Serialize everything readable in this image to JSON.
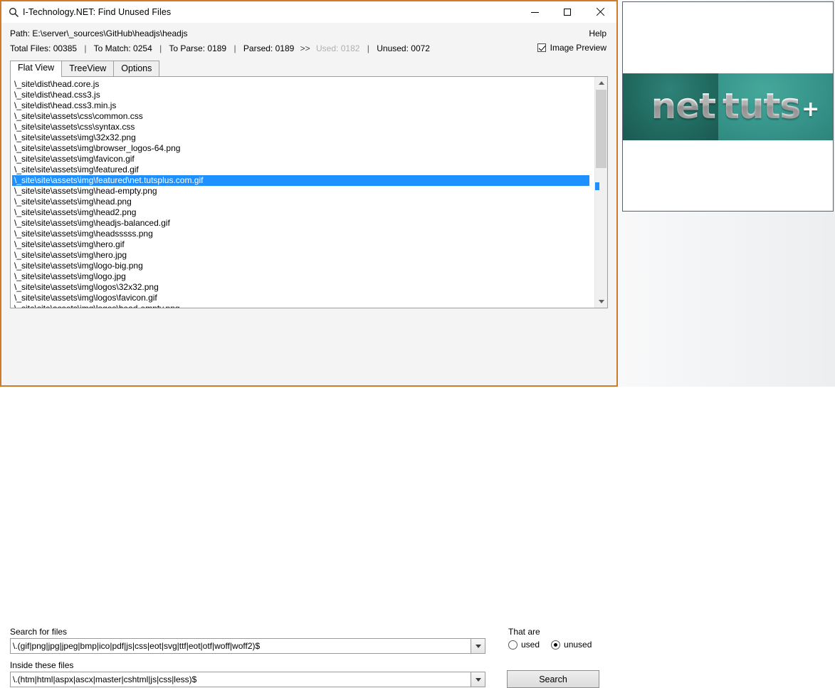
{
  "window": {
    "title": "I-Technology.NET: Find Unused Files",
    "icon": "magnifier-icon",
    "minimize_label": "Minimize",
    "maximize_label": "Maximize",
    "close_label": "Close",
    "accent_border_color": "#cf7b2a"
  },
  "header": {
    "path_label": "Path:",
    "path_value": "E:\\server\\_sources\\GitHub\\headjs\\headjs",
    "help_label": "Help",
    "stats": [
      {
        "label": "Total Files:",
        "value": "00385",
        "dim": false
      },
      {
        "label": "To Match:",
        "value": "0254",
        "dim": false
      },
      {
        "label": "To Parse:",
        "value": "0189",
        "dim": false
      },
      {
        "label": "Parsed:",
        "value": "0189",
        "dim": false
      },
      {
        "label": "Used:",
        "value": "0182",
        "dim": true
      },
      {
        "label": "Unused:",
        "value": "0072",
        "dim": false
      }
    ],
    "arrow": ">>",
    "separator": "|",
    "image_preview_label": "Image Preview",
    "image_preview_checked": true
  },
  "tabs": [
    {
      "label": "Flat View",
      "active": true
    },
    {
      "label": "TreeView",
      "active": false
    },
    {
      "label": "Options",
      "active": false
    }
  ],
  "file_list": {
    "selected_index": 9,
    "selection_color": "#1e90ff",
    "items": [
      "\\_site\\dist\\head.core.js",
      "\\_site\\dist\\head.css3.js",
      "\\_site\\dist\\head.css3.min.js",
      "\\_site\\site\\assets\\css\\common.css",
      "\\_site\\site\\assets\\css\\syntax.css",
      "\\_site\\site\\assets\\img\\32x32.png",
      "\\_site\\site\\assets\\img\\browser_logos-64.png",
      "\\_site\\site\\assets\\img\\favicon.gif",
      "\\_site\\site\\assets\\img\\featured.gif",
      "\\_site\\site\\assets\\img\\featured\\net.tutsplus.com.gif",
      "\\_site\\site\\assets\\img\\head-empty.png",
      "\\_site\\site\\assets\\img\\head.png",
      "\\_site\\site\\assets\\img\\head2.png",
      "\\_site\\site\\assets\\img\\headjs-balanced.gif",
      "\\_site\\site\\assets\\img\\headsssss.png",
      "\\_site\\site\\assets\\img\\hero.gif",
      "\\_site\\site\\assets\\img\\hero.jpg",
      "\\_site\\site\\assets\\img\\logo-big.png",
      "\\_site\\site\\assets\\img\\logo.jpg",
      "\\_site\\site\\assets\\img\\logos\\32x32.png",
      "\\_site\\site\\assets\\img\\logos\\favicon.gif",
      "\\_site\\site\\assets\\img\\logos\\head-empty.png"
    ]
  },
  "search_panel": {
    "search_for_files_label": "Search for files",
    "search_for_files_value": "\\.(gif|png|jpg|jpeg|bmp|ico|pdf|js|css|eot|svg|ttf|eot|otf|woff|woff2)$",
    "inside_these_files_label": "Inside these files",
    "inside_these_files_value": "\\.(htm|html|aspx|ascx|master|cshtml|js|css|less)$",
    "that_are_label": "That are",
    "radio_used_label": "used",
    "radio_unused_label": "unused",
    "radio_selected": "unused",
    "search_button_label": "Search"
  },
  "preview": {
    "logo_left_text": "net",
    "logo_right_text": "tuts",
    "logo_plus_text": "+",
    "left_color": "#20695f",
    "right_color": "#359389"
  }
}
